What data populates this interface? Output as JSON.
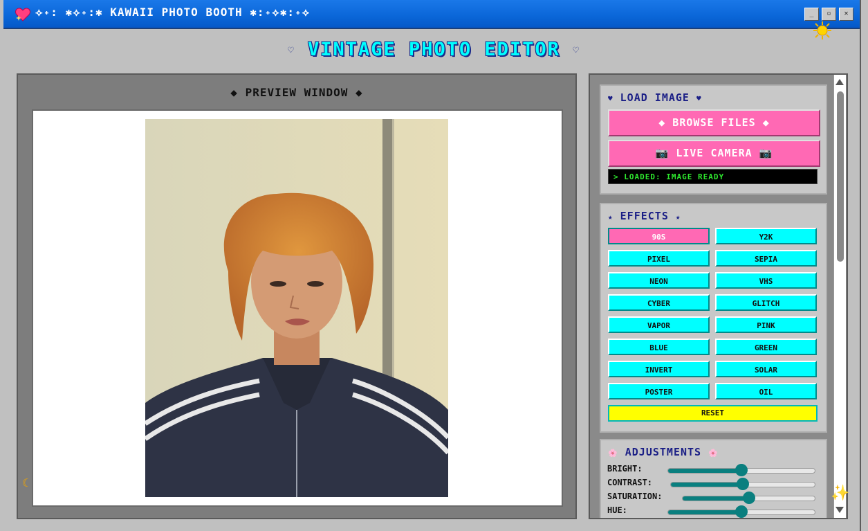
{
  "window": {
    "title": "⟡˖: ✱⟡˖:✱ KAWAII PHOTO BOOTH ✱:˖⟡✱:˖⟡",
    "heart_icon": "sparkle-heart-icon",
    "controls": {
      "minimize": "_",
      "maximize": "▫",
      "close": "✕"
    }
  },
  "heading": {
    "left_ornament": "♡",
    "text": "VINTAGE PHOTO EDITOR",
    "right_ornament": "♡"
  },
  "preview": {
    "title": "◆ PREVIEW WINDOW ◆",
    "photo_alt": "Portrait of young man with curly orange hair in navy track jacket"
  },
  "panel": {
    "load": {
      "title_prefix": "♥",
      "title": "LOAD IMAGE",
      "title_suffix": "♥",
      "browse": "◆ BROWSE FILES ◆",
      "camera": "📷 LIVE CAMERA 📷",
      "status": "> LOADED: IMAGE READY"
    },
    "effects": {
      "title_prefix": "★",
      "title": "EFFECTS",
      "title_suffix": "★",
      "buttons": [
        "90S",
        "Y2K",
        "PIXEL",
        "SEPIA",
        "NEON",
        "VHS",
        "CYBER",
        "GLITCH",
        "VAPOR",
        "PINK",
        "BLUE",
        "GREEN",
        "INVERT",
        "SOLAR",
        "POSTER",
        "OIL"
      ],
      "active": "90S",
      "reset": "RESET"
    },
    "adjustments": {
      "title_prefix": "🌸",
      "title": "ADJUSTMENTS",
      "title_suffix": "🌸",
      "items": [
        {
          "label": "BRIGHT:",
          "value": 0.5
        },
        {
          "label": "CONTRAST:",
          "value": 0.5
        },
        {
          "label": "SATURATION:",
          "value": 0.5
        },
        {
          "label": "HUE:",
          "value": 0.5
        }
      ]
    }
  },
  "colors": {
    "pink": "#ff69b4",
    "cyan": "#00ffff",
    "yellow": "#ffff00",
    "teal": "#0a7f7f",
    "navy": "#1b1f86"
  }
}
